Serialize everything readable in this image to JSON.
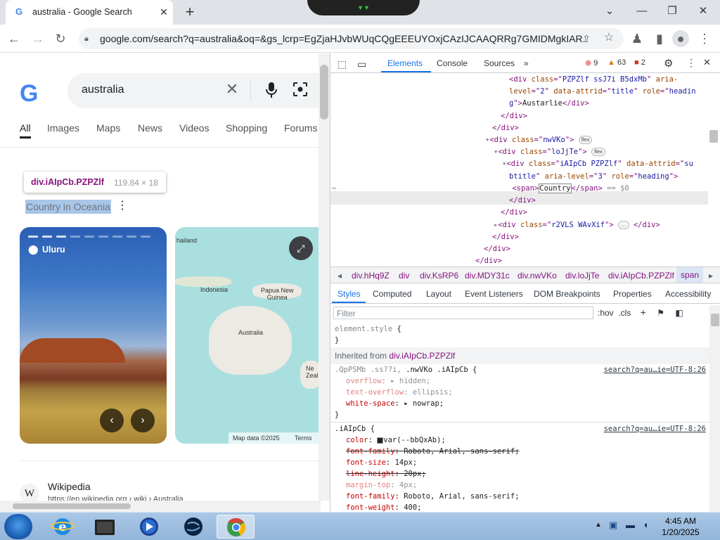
{
  "browser": {
    "tab_title": "australia - Google Search",
    "tab_icon": "G",
    "url": "google.com/search?q=australia&oq=&gs_lcrp=EgZjaHJvbWUqCQgEEEUYOxjCAzIJCAAQRRg7GMIDMgkIAR..."
  },
  "search": {
    "query": "australia",
    "tabs": [
      "All",
      "Images",
      "Maps",
      "News",
      "Videos",
      "Shopping",
      "Forums"
    ],
    "active_tab": "All"
  },
  "page": {
    "tooltip_selector": "div.iAIpCb.PZPZlf",
    "tooltip_dims": "119.84 × 18",
    "subtitle": "Country in Oceania",
    "image_caption": "Uluru",
    "map_labels": {
      "thailand": "hailand",
      "indonesia": "Indonesia",
      "png": "Papua New\nGuinea",
      "australia": "Australia",
      "nz": "Ne\nZeala"
    },
    "map_data": "Map data ©2025",
    "map_terms": "Terms",
    "wiki_title": "Wikipedia",
    "wiki_url": "https://en.wikipedia.org › wiki › Australia"
  },
  "devtools": {
    "tabs": [
      "Elements",
      "Console",
      "Sources"
    ],
    "active_tab": "Elements",
    "errors": "9",
    "warnings": "63",
    "issues": "2",
    "breadcrumbs": [
      "div.hHq9Z",
      "div",
      "div.KsRP6",
      "div.MDY31c",
      "div.nwVKo",
      "div.loJjTe",
      "div.iAIpCb.PZPZlf",
      "span"
    ],
    "panel_tabs": [
      "Styles",
      "Computed",
      "Layout",
      "Event Listeners",
      "DOM Breakpoints",
      "Properties",
      "Accessibility"
    ],
    "active_panel": "Styles",
    "filter_placeholder": "Filter",
    "tools": ":hov  .cls",
    "inherited_label": "Inherited from",
    "inherited_selector": "div.iAIpCb.PZPZlf",
    "source_link": "search?q=au…ie=UTF-8:26",
    "selected_text": "Country",
    "dollar_zero": "== $0"
  },
  "taskbar": {
    "time": "4:45 AM",
    "date": "1/20/2025"
  },
  "colors": {
    "accent": "#1a73e8",
    "tag": "#881280",
    "attr_name": "#994500",
    "attr_value": "#1a1aa6",
    "selection": "#a7c6e8"
  }
}
